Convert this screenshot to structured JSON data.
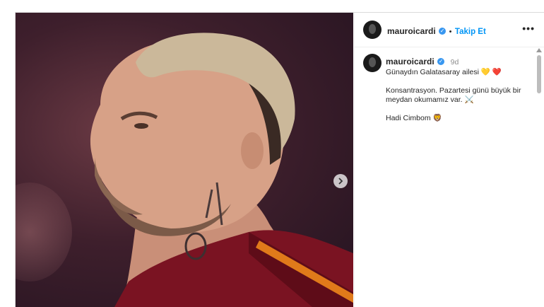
{
  "post": {
    "username": "mauroicardi",
    "follow_label": "Takip Et",
    "separator": "•",
    "more_label": "•••",
    "time_ago": "9d",
    "caption_line1": "Günaydın Galatasaray ailesi 💛 ❤️",
    "caption_line2": "Konsantrasyon. Pazartesi günü büyük bir meydan okumamız var. ⚔️",
    "caption_line3": "Hadi Cimbom 🦁"
  },
  "icons": {
    "next": "chevron-right-icon",
    "verified": "verified-badge-icon",
    "more": "more-options-icon"
  },
  "colors": {
    "follow_blue": "#0095f6",
    "verified_blue": "#3897f0"
  }
}
